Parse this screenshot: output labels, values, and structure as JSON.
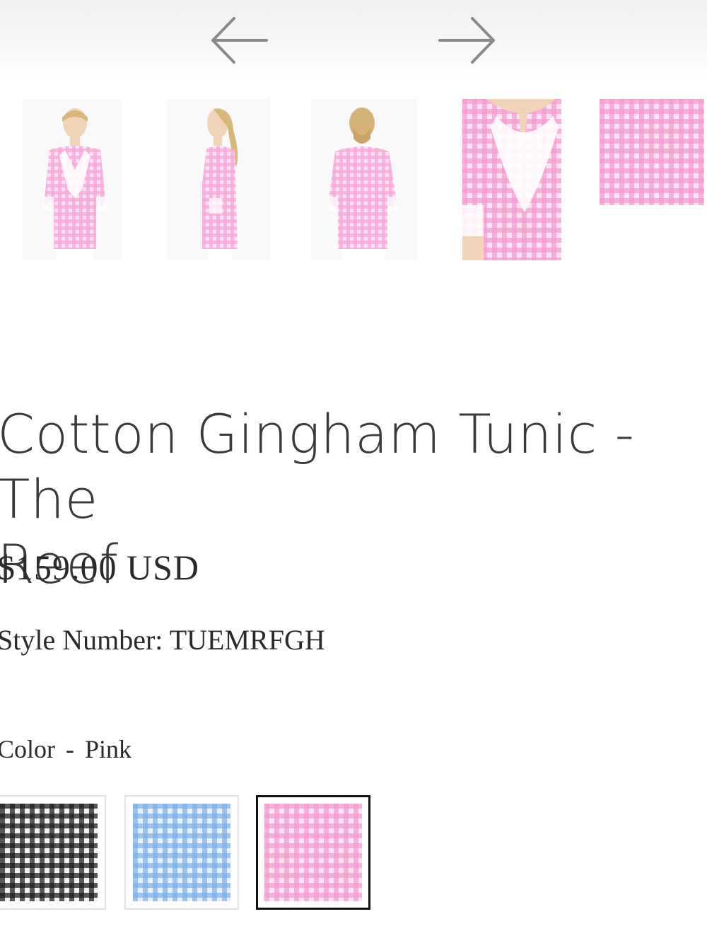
{
  "gallery": {
    "prev_icon": "arrow-left-icon",
    "next_icon": "arrow-right-icon",
    "thumbnails": [
      {
        "view": "front"
      },
      {
        "view": "side"
      },
      {
        "view": "back"
      },
      {
        "view": "detail"
      },
      {
        "view": "fabric"
      }
    ]
  },
  "product": {
    "title_line1": "Cotton Gingham Tunic - The",
    "title_line2": "Reef",
    "price": "$159.00 USD",
    "style_label": "Style Number:",
    "style_number": "TUEMRFGH",
    "color_label": "Color",
    "color_separator": "-",
    "color_value": "Pink"
  },
  "swatches": [
    {
      "name": "Black",
      "color": "#1c1c1c",
      "selected": false
    },
    {
      "name": "Blue",
      "color": "#7fb0e6",
      "selected": false
    },
    {
      "name": "Pink",
      "color": "#f09ccd",
      "selected": true
    }
  ],
  "colors": {
    "pink_gingham": "#f5a8d6",
    "blue_gingham": "#8bb8ea",
    "black_gingham": "#1c1c1c",
    "text": "#2a2a2a",
    "arrow": "#8a8a8a"
  }
}
